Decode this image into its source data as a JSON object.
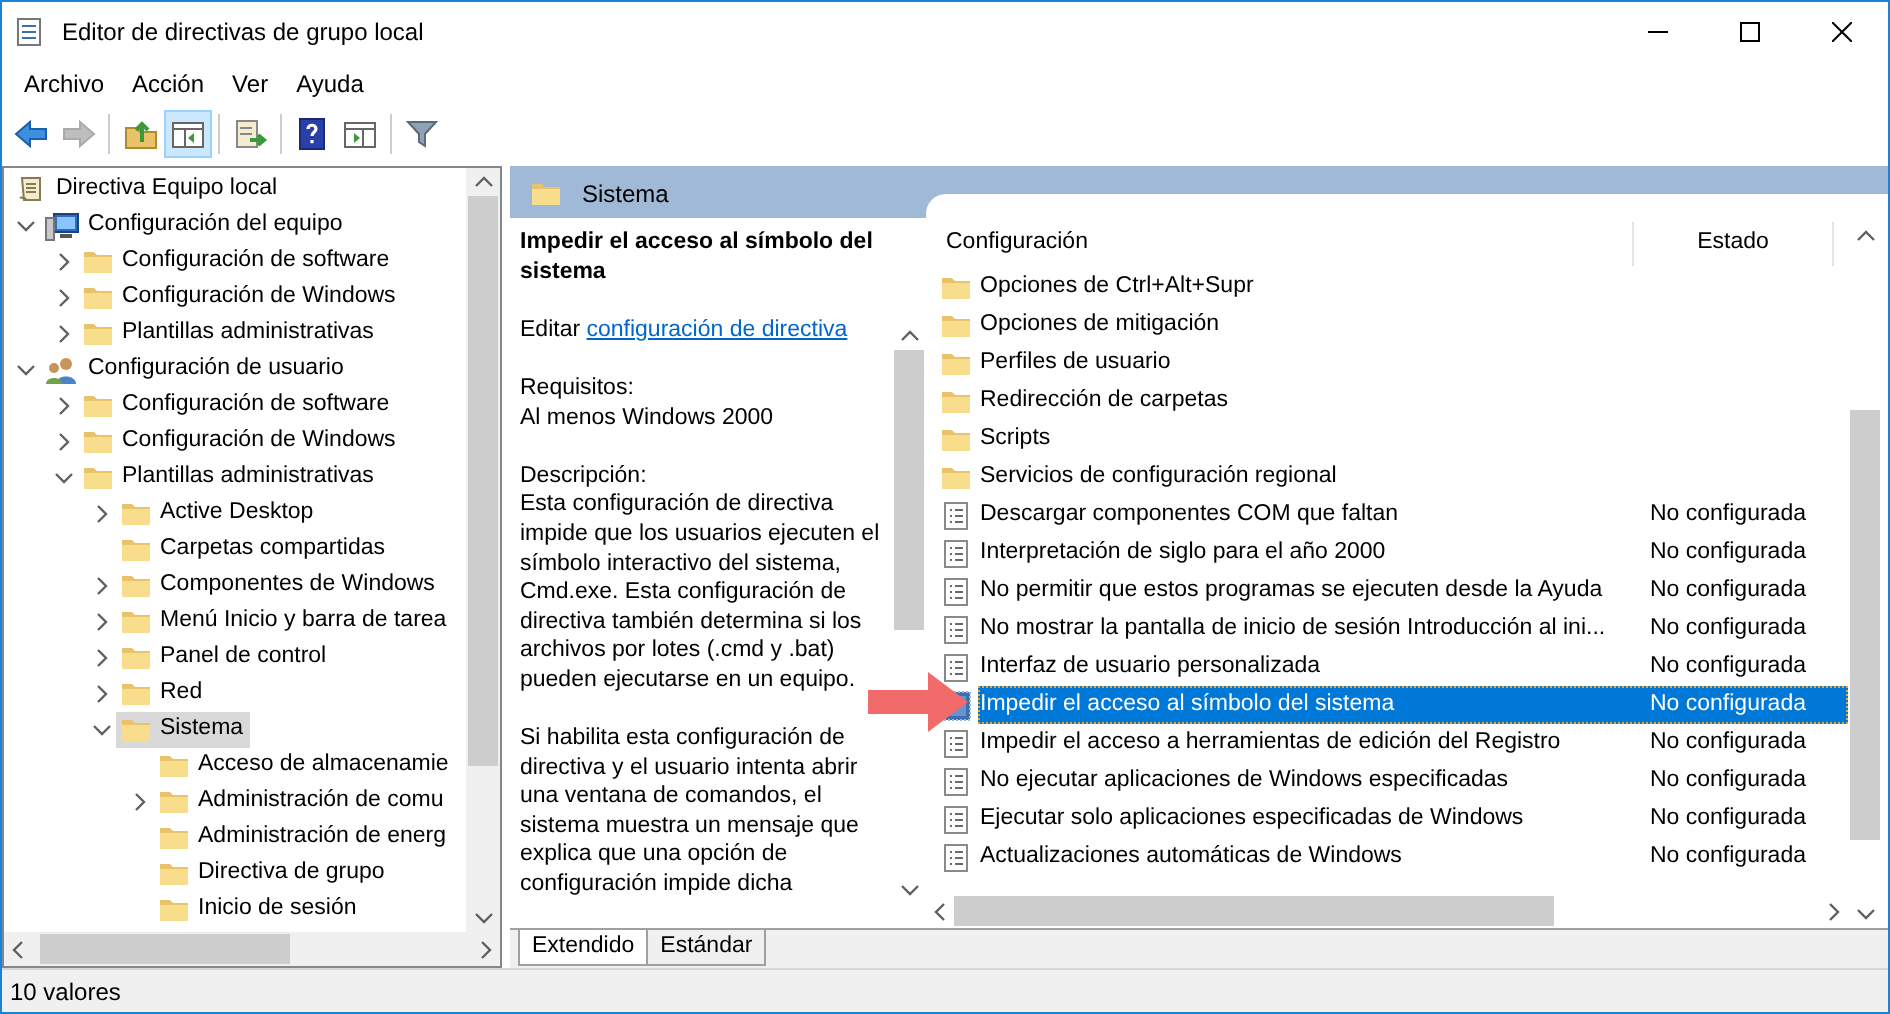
{
  "window": {
    "title": "Editor de directivas de grupo local"
  },
  "menu": [
    "Archivo",
    "Acción",
    "Ver",
    "Ayuda"
  ],
  "toolbar": [
    {
      "kind": "back",
      "pressed": false,
      "disabled": false
    },
    {
      "kind": "forward",
      "pressed": false,
      "disabled": true
    },
    {
      "kind": "up",
      "pressed": false,
      "disabled": false
    },
    {
      "kind": "tree",
      "pressed": true,
      "disabled": false
    },
    {
      "kind": "export",
      "pressed": false,
      "disabled": false
    },
    {
      "kind": "help",
      "pressed": false,
      "disabled": false
    },
    {
      "kind": "view",
      "pressed": false,
      "disabled": false
    },
    {
      "kind": "filter",
      "pressed": false,
      "disabled": false
    }
  ],
  "tree": [
    {
      "label": "Directiva Equipo local",
      "kind": "root",
      "selected": false,
      "children": [
        {
          "label": "Configuración del equipo",
          "kind": "computer",
          "expanded": true,
          "selected": false,
          "children": [
            {
              "label": "Configuración de software",
              "kind": "folder",
              "expanded": false,
              "selected": false
            },
            {
              "label": "Configuración de Windows",
              "kind": "folder",
              "expanded": false,
              "selected": false
            },
            {
              "label": "Plantillas administrativas",
              "kind": "folder",
              "expanded": false,
              "selected": false
            }
          ]
        },
        {
          "label": "Configuración de usuario",
          "kind": "user",
          "expanded": true,
          "selected": false,
          "children": [
            {
              "label": "Configuración de software",
              "kind": "folder",
              "expanded": false,
              "selected": false
            },
            {
              "label": "Configuración de Windows",
              "kind": "folder",
              "expanded": false,
              "selected": false
            },
            {
              "label": "Plantillas administrativas",
              "kind": "folder",
              "expanded": true,
              "selected": false,
              "children": [
                {
                  "label": "Active Desktop",
                  "kind": "folder",
                  "expanded": false,
                  "selected": false
                },
                {
                  "label": "Carpetas compartidas",
                  "kind": "folder",
                  "selected": false
                },
                {
                  "label": "Componentes de Windows",
                  "kind": "folder",
                  "expanded": false,
                  "selected": false
                },
                {
                  "label": "Menú Inicio y barra de tarea",
                  "kind": "folder",
                  "expanded": false,
                  "selected": false
                },
                {
                  "label": "Panel de control",
                  "kind": "folder",
                  "expanded": false,
                  "selected": false
                },
                {
                  "label": "Red",
                  "kind": "folder",
                  "expanded": false,
                  "selected": false
                },
                {
                  "label": "Sistema",
                  "kind": "folder",
                  "expanded": true,
                  "selected": true,
                  "children": [
                    {
                      "label": "Acceso de almacenamie",
                      "kind": "folder",
                      "selected": false
                    },
                    {
                      "label": "Administración de comu",
                      "kind": "folder",
                      "expanded": false,
                      "selected": false
                    },
                    {
                      "label": "Administración de energ",
                      "kind": "folder",
                      "selected": false
                    },
                    {
                      "label": "Directiva de grupo",
                      "kind": "folder",
                      "selected": false
                    },
                    {
                      "label": "Inicio de sesión",
                      "kind": "folder",
                      "selected": false
                    }
                  ]
                }
              ]
            }
          ]
        }
      ]
    }
  ],
  "folder_header": "Sistema",
  "details": {
    "title": "Impedir el acceso al símbolo del sistema",
    "edit_prefix": "Editar",
    "edit_link": "configuración de directiva",
    "requirements_label": "Requisitos:",
    "requirements": "Al menos Windows 2000",
    "description_label": "Descripción:",
    "paragraphs": [
      "Esta configuración de directiva impide que los usuarios ejecuten el símbolo interactivo del sistema, Cmd.exe.  Esta configuración de directiva también determina si los archivos por lotes (.cmd y .bat) pueden ejecutarse en un equipo.",
      "Si habilita esta configuración de directiva y el usuario intenta abrir una ventana de comandos, el sistema muestra un mensaje que explica que una opción de configuración impide dicha"
    ]
  },
  "columns": [
    "Configuración",
    "Estado"
  ],
  "rows": [
    {
      "kind": "folder",
      "name": "Opciones de Ctrl+Alt+Supr",
      "selected": false
    },
    {
      "kind": "folder",
      "name": "Opciones de mitigación",
      "selected": false
    },
    {
      "kind": "folder",
      "name": "Perfiles de usuario",
      "selected": false
    },
    {
      "kind": "folder",
      "name": "Redirección de carpetas",
      "selected": false
    },
    {
      "kind": "folder",
      "name": "Scripts",
      "selected": false
    },
    {
      "kind": "folder",
      "name": "Servicios de configuración regional",
      "selected": false
    },
    {
      "kind": "setting",
      "name": "Descargar componentes COM que faltan",
      "state": "No configurada",
      "selected": false
    },
    {
      "kind": "setting",
      "name": "Interpretación de siglo para el año 2000",
      "state": "No configurada",
      "selected": false
    },
    {
      "kind": "setting",
      "name": "No permitir que estos programas se ejecuten desde la Ayuda",
      "state": "No configurada",
      "selected": false
    },
    {
      "kind": "setting",
      "name": "No mostrar la pantalla de inicio de sesión Introducción al ini...",
      "state": "No configurada",
      "selected": false
    },
    {
      "kind": "setting",
      "name": "Interfaz de usuario personalizada",
      "state": "No configurada",
      "selected": false
    },
    {
      "kind": "setting",
      "name": "Impedir el acceso al símbolo del sistema",
      "state": "No configurada",
      "selected": true
    },
    {
      "kind": "setting",
      "name": "Impedir el acceso a herramientas de edición del Registro",
      "state": "No configurada",
      "selected": false
    },
    {
      "kind": "setting",
      "name": "No ejecutar aplicaciones de Windows especificadas",
      "state": "No configurada",
      "selected": false
    },
    {
      "kind": "setting",
      "name": "Ejecutar solo aplicaciones especificadas de Windows",
      "state": "No configurada",
      "selected": false
    },
    {
      "kind": "setting",
      "name": "Actualizaciones automáticas de Windows",
      "state": "No configurada",
      "selected": false
    }
  ],
  "tabs": [
    {
      "label": "Extendido",
      "selected": true
    },
    {
      "label": "Estándar",
      "selected": false
    }
  ],
  "status_bar": "10 valores"
}
